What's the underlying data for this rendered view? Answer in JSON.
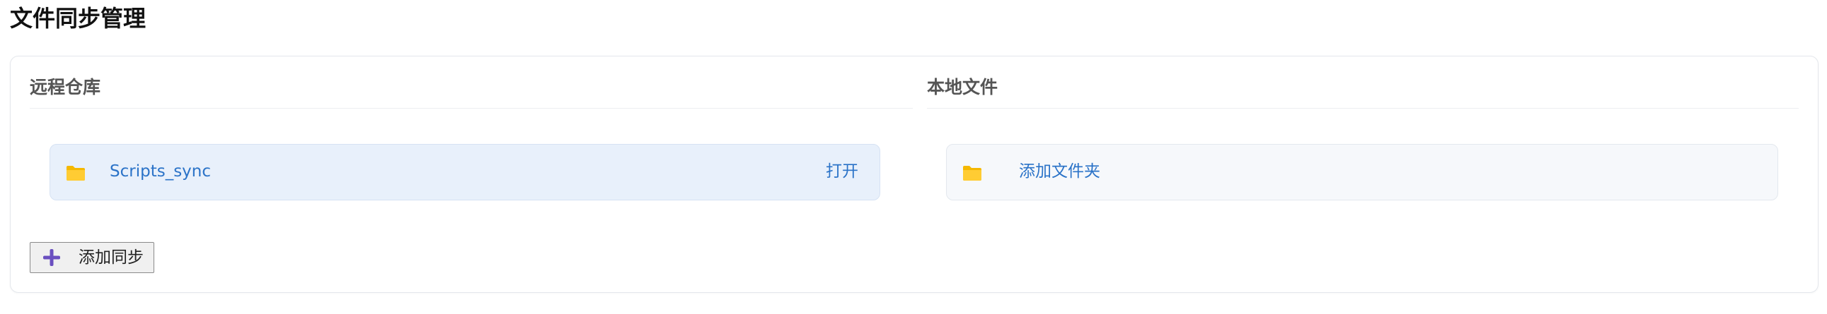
{
  "page": {
    "title": "文件同步管理"
  },
  "remote": {
    "title": "远程仓库",
    "items": [
      {
        "name": "Scripts_sync",
        "icon": "folder-icon",
        "action_label": "打开"
      }
    ]
  },
  "local": {
    "title": "本地文件",
    "items": [
      {
        "name": "添加文件夹",
        "icon": "folder-icon"
      }
    ]
  },
  "actions": {
    "add_sync_label": "添加同步",
    "add_sync_icon": "plus-icon"
  },
  "colors": {
    "folder": "#f5c400",
    "link": "#2b73c8",
    "plus": "#6a4fc0",
    "remote_row_bg": "#e8f0fb"
  }
}
